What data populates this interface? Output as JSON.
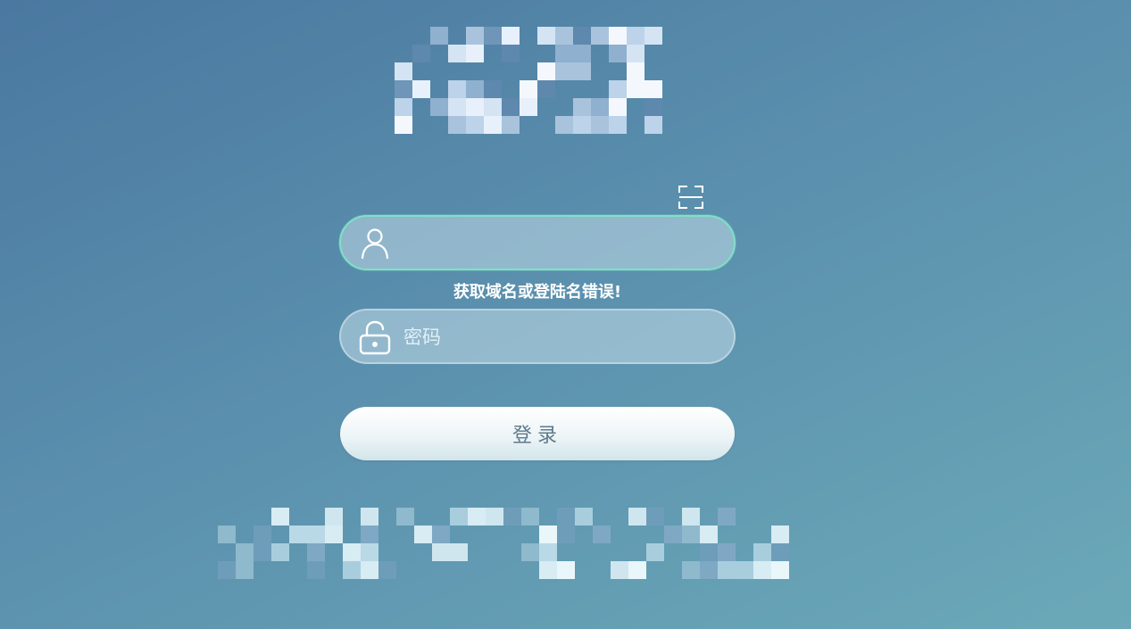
{
  "login_form": {
    "username": {
      "value": "",
      "placeholder": ""
    },
    "error_message": "获取域名或登陆名错误!",
    "password": {
      "value": "",
      "placeholder": "密码"
    },
    "login_button_label": "登录"
  },
  "colors": {
    "background_start": "#4a78a0",
    "background_end": "#6ba9b8",
    "active_field_border": "#7fe0c6",
    "login_button_text": "#5c7a8c"
  },
  "icons": {
    "scan": "scan-icon",
    "user": "user-icon",
    "lock": "unlock-icon"
  }
}
